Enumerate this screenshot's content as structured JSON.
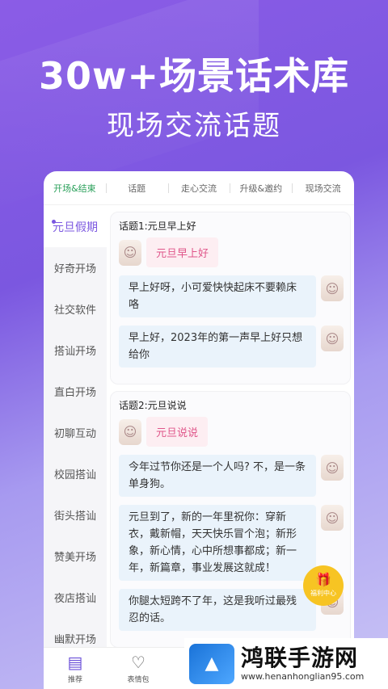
{
  "promo": {
    "title": "30w+场景话术库",
    "subtitle": "现场交流话题"
  },
  "tabs": [
    {
      "label": "开场&结束",
      "active": true
    },
    {
      "label": "话题",
      "active": false
    },
    {
      "label": "走心交流",
      "active": false
    },
    {
      "label": "升级&邀约",
      "active": false
    },
    {
      "label": "现场交流",
      "active": false
    }
  ],
  "sidebar": {
    "items": [
      {
        "label": "元旦假期",
        "active": true
      },
      {
        "label": "好奇开场"
      },
      {
        "label": "社交软件"
      },
      {
        "label": "搭讪开场"
      },
      {
        "label": "直白开场"
      },
      {
        "label": "初聊互动"
      },
      {
        "label": "校园搭讪"
      },
      {
        "label": "街头搭讪"
      },
      {
        "label": "赞美开场"
      },
      {
        "label": "夜店搭讪"
      },
      {
        "label": "幽默开场"
      }
    ]
  },
  "topics": [
    {
      "title": "话题1:元旦早上好",
      "question": "元旦早上好",
      "answers": [
        "早上好呀，小可爱快快起床不要赖床咯",
        "早上好，2023年的第一声早上好只想给你"
      ]
    },
    {
      "title": "话题2:元旦说说",
      "question": "元旦说说",
      "answers": [
        "今年过节你还是一个人吗? 不，是一条单身狗。",
        "元旦到了，新的一年里祝你：穿新衣，戴新帽，天天快乐冒个泡；新形象，新心情，心中所想事都成；新一年，新篇章，事业发展这就成！",
        "你腿太短跨不了年，这是我听过最残忍的话。"
      ]
    }
  ],
  "gift": {
    "label": "福利中心",
    "icon": "gift-icon"
  },
  "bottom_nav": [
    {
      "label": "推荐",
      "icon": "list-icon",
      "active": true
    },
    {
      "label": "表情包",
      "icon": "user-heart-icon",
      "active": false
    }
  ],
  "watermark": {
    "name": "鸿联手游网",
    "url": "www.henanhonglian95.com"
  },
  "colors": {
    "accent": "#7b57e0",
    "tab_active": "#2aa05a",
    "question_text": "#e0568a",
    "gift": "#f7c423"
  }
}
